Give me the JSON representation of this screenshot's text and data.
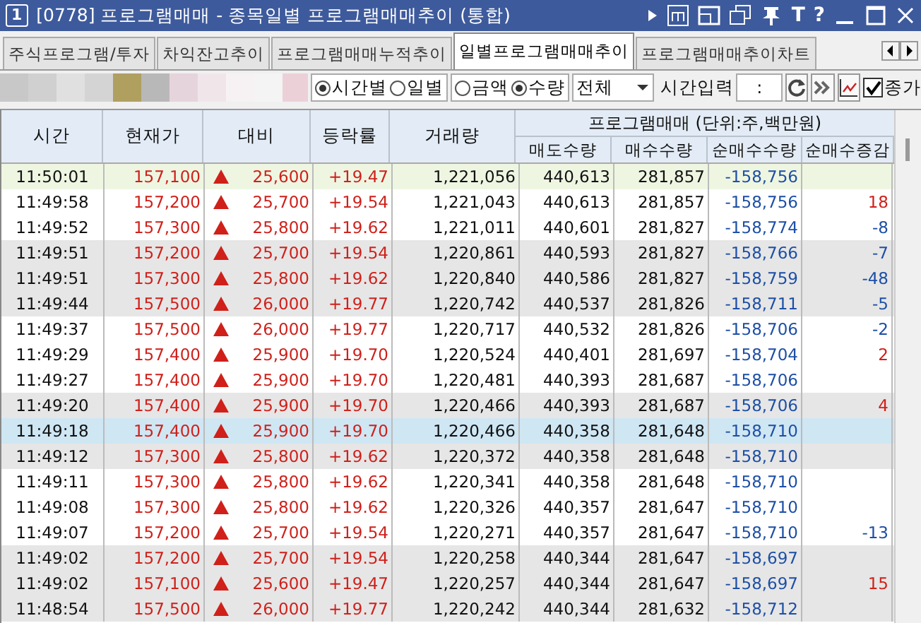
{
  "window": {
    "badge": "1",
    "title": "[0778] 프로그램매매 - 종목일별 프로그램매매추이 (통합)",
    "text_buttons": [
      "T",
      "?"
    ]
  },
  "tabs": [
    {
      "label": "주식프로그램/투자",
      "selected": false
    },
    {
      "label": "차익잔고추이",
      "selected": false
    },
    {
      "label": "프로그램매매누적추이",
      "selected": false
    },
    {
      "label": "일별프로그램매매추이",
      "selected": true
    },
    {
      "label": "프로그램매매추이차트",
      "selected": false
    }
  ],
  "period_options": [
    {
      "label": "시간별",
      "selected": true
    },
    {
      "label": "일별",
      "selected": false
    }
  ],
  "unit_options": [
    {
      "label": "금액",
      "selected": false
    },
    {
      "label": "수량",
      "selected": true
    }
  ],
  "filter": {
    "value": "전체"
  },
  "time_input": {
    "label": "시간입력",
    "value": ":"
  },
  "close_price": {
    "label": "종가",
    "checked": true
  },
  "table": {
    "columns": [
      "시간",
      "현재가",
      "대비",
      "등락률",
      "거래량"
    ],
    "group": "프로그램매매 (단위:주,백만원)",
    "sub_columns": [
      "매도수량",
      "매수수량",
      "순매수수량",
      "순매수증감"
    ],
    "rows": [
      {
        "kind": "latest",
        "selected": false,
        "up": true,
        "time": "11:50:01",
        "price": "157,100",
        "change": "25,600",
        "rate": "+19.47",
        "volume": "1,221,056",
        "sell": "440,613",
        "buy": "281,857",
        "net": "-158,756"
      },
      {
        "kind": "plain",
        "selected": false,
        "up": true,
        "time": "11:49:58",
        "price": "157,200",
        "change": "25,700",
        "rate": "+19.54",
        "volume": "1,221,043",
        "sell": "440,613",
        "buy": "281,857",
        "net": "-158,756",
        "delta": {
          "text": "18",
          "up": true
        }
      },
      {
        "kind": "plain",
        "selected": false,
        "up": true,
        "time": "11:49:52",
        "price": "157,300",
        "change": "25,800",
        "rate": "+19.62",
        "volume": "1,221,011",
        "sell": "440,601",
        "buy": "281,827",
        "net": "-158,774",
        "delta": {
          "text": "-8",
          "up": false
        }
      },
      {
        "kind": "grey",
        "selected": false,
        "up": true,
        "time": "11:49:51",
        "price": "157,200",
        "change": "25,700",
        "rate": "+19.54",
        "volume": "1,220,861",
        "sell": "440,593",
        "buy": "281,827",
        "net": "-158,766",
        "delta": {
          "text": "-7",
          "up": false
        }
      },
      {
        "kind": "grey",
        "selected": false,
        "up": true,
        "time": "11:49:51",
        "price": "157,300",
        "change": "25,800",
        "rate": "+19.62",
        "volume": "1,220,840",
        "sell": "440,586",
        "buy": "281,827",
        "net": "-158,759",
        "delta": {
          "text": "-48",
          "up": false
        }
      },
      {
        "kind": "grey",
        "selected": false,
        "up": true,
        "time": "11:49:44",
        "price": "157,500",
        "change": "26,000",
        "rate": "+19.77",
        "volume": "1,220,742",
        "sell": "440,537",
        "buy": "281,826",
        "net": "-158,711",
        "delta": {
          "text": "-5",
          "up": false
        }
      },
      {
        "kind": "plain",
        "selected": false,
        "up": true,
        "time": "11:49:37",
        "price": "157,500",
        "change": "26,000",
        "rate": "+19.77",
        "volume": "1,220,717",
        "sell": "440,532",
        "buy": "281,826",
        "net": "-158,706",
        "delta": {
          "text": "-2",
          "up": false
        }
      },
      {
        "kind": "plain",
        "selected": false,
        "up": true,
        "time": "11:49:29",
        "price": "157,400",
        "change": "25,900",
        "rate": "+19.70",
        "volume": "1,220,524",
        "sell": "440,401",
        "buy": "281,697",
        "net": "-158,704",
        "delta": {
          "text": "2",
          "up": true
        }
      },
      {
        "kind": "plain",
        "selected": false,
        "up": true,
        "time": "11:49:27",
        "price": "157,400",
        "change": "25,900",
        "rate": "+19.70",
        "volume": "1,220,481",
        "sell": "440,393",
        "buy": "281,687",
        "net": "-158,706"
      },
      {
        "kind": "grey",
        "selected": false,
        "up": true,
        "time": "11:49:20",
        "price": "157,400",
        "change": "25,900",
        "rate": "+19.70",
        "volume": "1,220,466",
        "sell": "440,393",
        "buy": "281,687",
        "net": "-158,706",
        "delta": {
          "text": "4",
          "up": true
        }
      },
      {
        "selected": true,
        "up": true,
        "time": "11:49:18",
        "price": "157,400",
        "change": "25,900",
        "rate": "+19.70",
        "volume": "1,220,466",
        "sell": "440,358",
        "buy": "281,648",
        "net": "-158,710"
      },
      {
        "kind": "grey",
        "selected": false,
        "up": true,
        "time": "11:49:12",
        "price": "157,300",
        "change": "25,800",
        "rate": "+19.62",
        "volume": "1,220,372",
        "sell": "440,358",
        "buy": "281,648",
        "net": "-158,710"
      },
      {
        "kind": "plain",
        "selected": false,
        "up": true,
        "time": "11:49:11",
        "price": "157,300",
        "change": "25,800",
        "rate": "+19.62",
        "volume": "1,220,341",
        "sell": "440,358",
        "buy": "281,648",
        "net": "-158,710"
      },
      {
        "kind": "plain",
        "selected": false,
        "up": true,
        "time": "11:49:08",
        "price": "157,300",
        "change": "25,800",
        "rate": "+19.62",
        "volume": "1,220,326",
        "sell": "440,357",
        "buy": "281,647",
        "net": "-158,710"
      },
      {
        "kind": "plain",
        "selected": false,
        "up": true,
        "time": "11:49:07",
        "price": "157,200",
        "change": "25,700",
        "rate": "+19.54",
        "volume": "1,220,271",
        "sell": "440,357",
        "buy": "281,647",
        "net": "-158,710",
        "delta": {
          "text": "-13",
          "up": false
        }
      },
      {
        "kind": "grey",
        "selected": false,
        "up": true,
        "time": "11:49:02",
        "price": "157,200",
        "change": "25,700",
        "rate": "+19.54",
        "volume": "1,220,258",
        "sell": "440,344",
        "buy": "281,647",
        "net": "-158,697"
      },
      {
        "kind": "grey",
        "selected": false,
        "up": true,
        "time": "11:49:02",
        "price": "157,100",
        "change": "25,600",
        "rate": "+19.47",
        "volume": "1,220,257",
        "sell": "440,344",
        "buy": "281,647",
        "net": "-158,697",
        "delta": {
          "text": "15",
          "up": true
        }
      },
      {
        "kind": "grey",
        "selected": false,
        "up": true,
        "time": "11:48:54",
        "price": "157,500",
        "change": "26,000",
        "rate": "+19.77",
        "volume": "1,220,242",
        "sell": "440,344",
        "buy": "281,632",
        "net": "-158,712"
      }
    ]
  }
}
